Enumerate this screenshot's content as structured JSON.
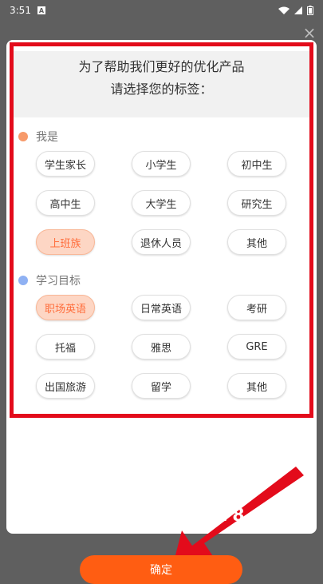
{
  "status_bar": {
    "time": "3:51",
    "badge": "A",
    "icons": [
      "wifi-icon",
      "cell-signal-icon",
      "battery-icon"
    ]
  },
  "modal": {
    "header": {
      "line1": "为了帮助我们更好的优化产品",
      "line2": "请选择您的标签："
    },
    "sections": [
      {
        "title": "我是",
        "dot_color": "#f79a6a",
        "items": [
          {
            "label": "学生家长",
            "selected": false
          },
          {
            "label": "小学生",
            "selected": false
          },
          {
            "label": "初中生",
            "selected": false
          },
          {
            "label": "高中生",
            "selected": false
          },
          {
            "label": "大学生",
            "selected": false
          },
          {
            "label": "研究生",
            "selected": false
          },
          {
            "label": "上班族",
            "selected": true
          },
          {
            "label": "退休人员",
            "selected": false
          },
          {
            "label": "其他",
            "selected": false
          }
        ]
      },
      {
        "title": "学习目标",
        "dot_color": "#8fb1f3",
        "items": [
          {
            "label": "职场英语",
            "selected": true
          },
          {
            "label": "日常英语",
            "selected": false
          },
          {
            "label": "考研",
            "selected": false
          },
          {
            "label": "托福",
            "selected": false
          },
          {
            "label": "雅思",
            "selected": false
          },
          {
            "label": "GRE",
            "selected": false
          },
          {
            "label": "出国旅游",
            "selected": false
          },
          {
            "label": "留学",
            "selected": false
          },
          {
            "label": "其他",
            "selected": false
          }
        ]
      }
    ]
  },
  "overlay": {
    "number_text": "78"
  },
  "confirm_button": {
    "label": "确定"
  },
  "colors": {
    "accent": "#ff5d12",
    "highlight_frame": "#e30b1b",
    "selected_chip_bg": "#fdd6c4",
    "selected_chip_text": "#ff6e3d"
  }
}
